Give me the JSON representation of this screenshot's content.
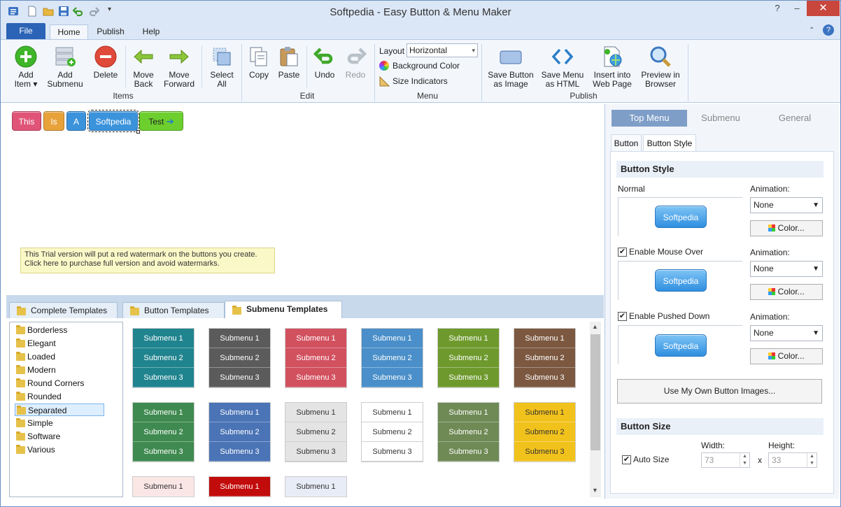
{
  "app": {
    "title": "Softpedia - Easy Button & Menu Maker"
  },
  "ribbon_tabs": [
    "File",
    "Home",
    "Publish",
    "Help"
  ],
  "ribbon": {
    "items": [
      {
        "label1": "Add",
        "label2": "Item ▾"
      },
      {
        "label1": "Add",
        "label2": "Submenu"
      },
      {
        "label1": "Delete",
        "label2": ""
      },
      {
        "label1": "Move",
        "label2": "Back"
      },
      {
        "label1": "Move",
        "label2": "Forward"
      },
      {
        "label1": "Select",
        "label2": "All"
      }
    ],
    "items_group": "Items",
    "edit": [
      {
        "label1": "Copy",
        "label2": ""
      },
      {
        "label1": "Paste",
        "label2": ""
      },
      {
        "label1": "Undo",
        "label2": ""
      },
      {
        "label1": "Redo",
        "label2": ""
      }
    ],
    "edit_group": "Edit",
    "menu": {
      "layout_label": "Layout",
      "layout_value": "Horizontal",
      "background_color": "Background Color",
      "size_indicators": "Size Indicators"
    },
    "menu_group": "Menu",
    "publish": [
      {
        "label1": "Save Button",
        "label2": "as Image"
      },
      {
        "label1": "Save Menu",
        "label2": "as HTML"
      },
      {
        "label1": "Insert into",
        "label2": "Web Page"
      },
      {
        "label1": "Preview in",
        "label2": "Browser"
      }
    ],
    "publish_group": "Publish"
  },
  "canvas": {
    "buttons": [
      {
        "label": "This",
        "color": "#e05478"
      },
      {
        "label": "Is",
        "color": "#e8a23a"
      },
      {
        "label": "A",
        "color": "#3b93dc"
      },
      {
        "label": "Softpedia",
        "color": "#3b93dc"
      },
      {
        "label": "Test",
        "color": "#6ccf2e"
      }
    ],
    "trial_line1": "This Trial version will put a red watermark on the buttons you create.",
    "trial_line2": "Click here to purchase full version and avoid watermarks."
  },
  "template_tabs": [
    "Complete Templates",
    "Button Templates",
    "Submenu Templates"
  ],
  "template_tree": [
    "Borderless",
    "Elegant",
    "Loaded",
    "Modern",
    "Round Corners",
    "Rounded",
    "Separated",
    "Simple",
    "Software",
    "Various"
  ],
  "template_selected": "Separated",
  "submenu_labels": [
    "Submenu 1",
    "Submenu 2",
    "Submenu 3"
  ],
  "submenu_templates": [
    {
      "bg": "#20848f",
      "fg": "#ffffff"
    },
    {
      "bg": "#5b5b5b",
      "fg": "#ffffff"
    },
    {
      "bg": "#d2515f",
      "fg": "#ffffff"
    },
    {
      "bg": "#4a8fc9",
      "fg": "#ffffff"
    },
    {
      "bg": "#6e9a2d",
      "fg": "#ffffff"
    },
    {
      "bg": "#7c5840",
      "fg": "#ffffff"
    },
    {
      "bg": "#3f8a50",
      "fg": "#ffffff"
    },
    {
      "bg": "#4b74b6",
      "fg": "#ffffff"
    },
    {
      "bg": "#e4e4e4",
      "fg": "#333333"
    },
    {
      "bg": "#ffffff",
      "fg": "#333333"
    },
    {
      "bg": "#6f8a55",
      "fg": "#ffffff"
    },
    {
      "bg": "#f2c21c",
      "fg": "#333333"
    },
    {
      "bg": "#fbe6e6",
      "fg": "#333333"
    },
    {
      "bg": "#c20b0b",
      "fg": "#ffffff"
    },
    {
      "bg": "#e8ecf6",
      "fg": "#333333"
    }
  ],
  "right_panel": {
    "tabs": [
      "Top Menu",
      "Submenu",
      "General"
    ],
    "subtabs": [
      "Button",
      "Button Style"
    ],
    "button_style_header": "Button Style",
    "normal_label": "Normal",
    "animation_label": "Animation:",
    "animation_value": "None",
    "color_button": "Color...",
    "preview_text": "Softpedia",
    "enable_mouse_over": "Enable  Mouse Over",
    "enable_pushed_down": "Enable Pushed Down",
    "use_own_images": "Use My Own Button Images...",
    "button_size_header": "Button Size",
    "auto_size": "Auto Size",
    "width_label": "Width:",
    "height_label": "Height:",
    "width_value": "73",
    "height_value": "33",
    "x_sep": "x"
  }
}
